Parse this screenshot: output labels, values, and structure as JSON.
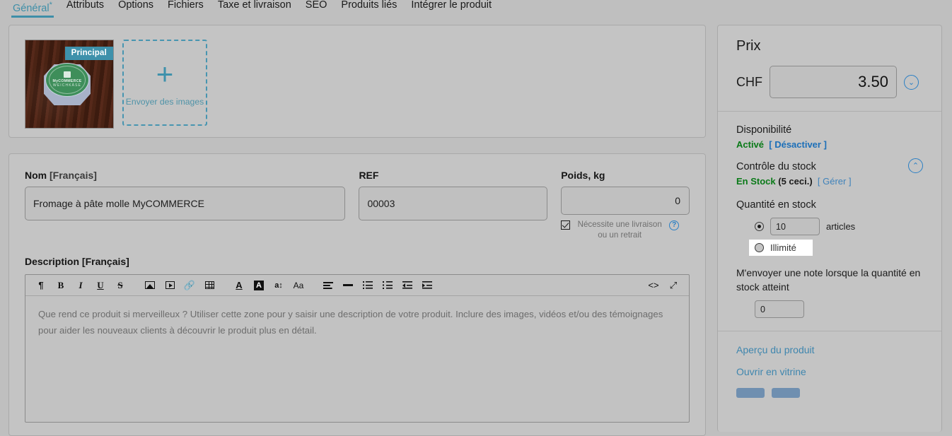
{
  "tabs": [
    {
      "label": "Général",
      "star": "*",
      "active": true
    },
    {
      "label": "Attributs",
      "star": "",
      "active": false
    },
    {
      "label": "Options",
      "star": "",
      "active": false
    },
    {
      "label": "Fichiers",
      "star": "",
      "active": false
    },
    {
      "label": "Taxe et livraison",
      "star": "",
      "active": false
    },
    {
      "label": "SEO",
      "star": "",
      "active": false
    },
    {
      "label": "Produits liés",
      "star": "",
      "active": false
    },
    {
      "label": "Intégrer le produit",
      "star": "",
      "active": false
    }
  ],
  "images": {
    "main_badge": "Principal",
    "product_brand_line1": "MyCOMMERCE",
    "product_brand_line2": "WEICHKÄSE",
    "upload_label": "Envoyer des images",
    "upload_plus": "+"
  },
  "fields": {
    "name_label": "Nom",
    "name_lang": "[Français]",
    "name_value": "Fromage à pâte molle MyCOMMERCE",
    "ref_label": "REF",
    "ref_value": "00003",
    "weight_label": "Poids, kg",
    "weight_value": "0",
    "shipping_checkbox_label": "Nécessite une livraison ou un retrait",
    "help_glyph": "?"
  },
  "description": {
    "label": "Description",
    "lang": "[Français]",
    "placeholder": "Que rend ce produit si merveilleux ? Utiliser cette zone pour y saisir une description de votre produit. Inclure des images, vidéos et/ou des témoignages pour aider les nouveaux clients à découvrir le produit plus en détail.",
    "toolbar": [
      {
        "name": "paragraph-icon",
        "glyph": "¶"
      },
      {
        "name": "bold-icon",
        "glyph": "B"
      },
      {
        "name": "italic-icon",
        "glyph": "I"
      },
      {
        "name": "underline-icon",
        "glyph": "U"
      },
      {
        "name": "strikethrough-icon",
        "glyph": "S"
      },
      {
        "name": "insert-image-icon",
        "glyph": ""
      },
      {
        "name": "insert-video-icon",
        "glyph": ""
      },
      {
        "name": "insert-link-icon",
        "glyph": "∞"
      },
      {
        "name": "insert-table-icon",
        "glyph": ""
      },
      {
        "name": "text-color-icon",
        "glyph": "A"
      },
      {
        "name": "background-color-icon",
        "glyph": "A"
      },
      {
        "name": "line-height-icon",
        "glyph": "a⇕"
      },
      {
        "name": "font-size-icon",
        "glyph": "Aa"
      },
      {
        "name": "align-icon",
        "glyph": ""
      },
      {
        "name": "horizontal-rule-icon",
        "glyph": ""
      },
      {
        "name": "bullet-list-icon",
        "glyph": ""
      },
      {
        "name": "numbered-list-icon",
        "glyph": ""
      },
      {
        "name": "outdent-icon",
        "glyph": ""
      },
      {
        "name": "indent-icon",
        "glyph": ""
      }
    ],
    "source_code_glyph": "<>",
    "fullscreen_glyph": "⤢"
  },
  "sidebar": {
    "price_title": "Prix",
    "currency": "CHF",
    "price_value": "3.50",
    "price_expand_glyph": "⌄",
    "availability_label": "Disponibilité",
    "availability_status": "Activé",
    "availability_action": "[ Désactiver ]",
    "stock_control_label": "Contrôle du stock",
    "stock_status": "En Stock",
    "stock_count": "(5 ceci.)",
    "stock_action": "[ Gérer ]",
    "stock_collapse_glyph": "⌃",
    "quantity_label": "Quantité en stock",
    "quantity_value": "10",
    "quantity_unit": "articles",
    "unlimited_label": "Illimité",
    "note_text": "M'envoyer une note lorsque la quantité en stock atteint",
    "threshold_value": "0",
    "preview_link": "Aperçu du produit",
    "storefront_link": "Ouvrir en vitrine"
  }
}
